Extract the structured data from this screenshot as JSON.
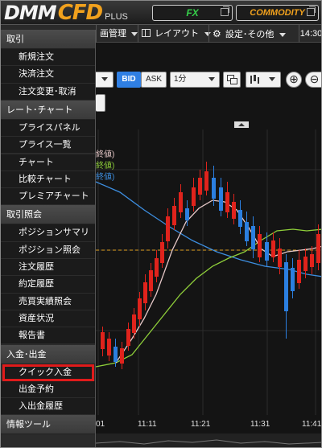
{
  "header": {
    "logo_main": "DMM",
    "logo_cfd": "CFD",
    "logo_suffix": "PLUS",
    "product_fx": "FX",
    "product_commodity": "COMMODITY"
  },
  "menubar": {
    "item_chart_manage": "画管理",
    "item_layout": "レイアウト",
    "item_settings": "設定･その他",
    "time": "14:30"
  },
  "toolbar": {
    "bid": "BID",
    "ask": "ASK",
    "interval": "1分"
  },
  "legend": [
    "終値)",
    "終値)",
    "終値)"
  ],
  "xaxis": [
    "01",
    "11:11",
    "11:21",
    "11:31",
    "11:41"
  ],
  "sidebar": {
    "sections": [
      {
        "label": "取引",
        "items": [
          "新規注文",
          "決済注文",
          "注文変更･取消"
        ]
      },
      {
        "label": "レート･チャート",
        "items": [
          "プライスパネル",
          "プライス一覧",
          "チャート",
          "比較チャート",
          "プレミアチャート"
        ]
      },
      {
        "label": "取引照会",
        "items": [
          "ポジションサマリ",
          "ポジション照会",
          "注文履歴",
          "約定履歴",
          "売買実績照会",
          "資産状況",
          "報告書"
        ]
      },
      {
        "label": "入金･出金",
        "items": [
          "クイック入金",
          "出金予約",
          "入出金履歴"
        ]
      },
      {
        "label": "情報ツール",
        "items": []
      }
    ],
    "active_item": "クイック入金"
  },
  "colors": {
    "candle_up": "#e0231c",
    "candle_down": "#2b7fe0",
    "ma_short": "#e6c8c8",
    "ma_mid": "#8fcf3a",
    "ma_long": "#3d8ee0",
    "price_line": "#e0a020",
    "highlight": "#e01b1b"
  }
}
